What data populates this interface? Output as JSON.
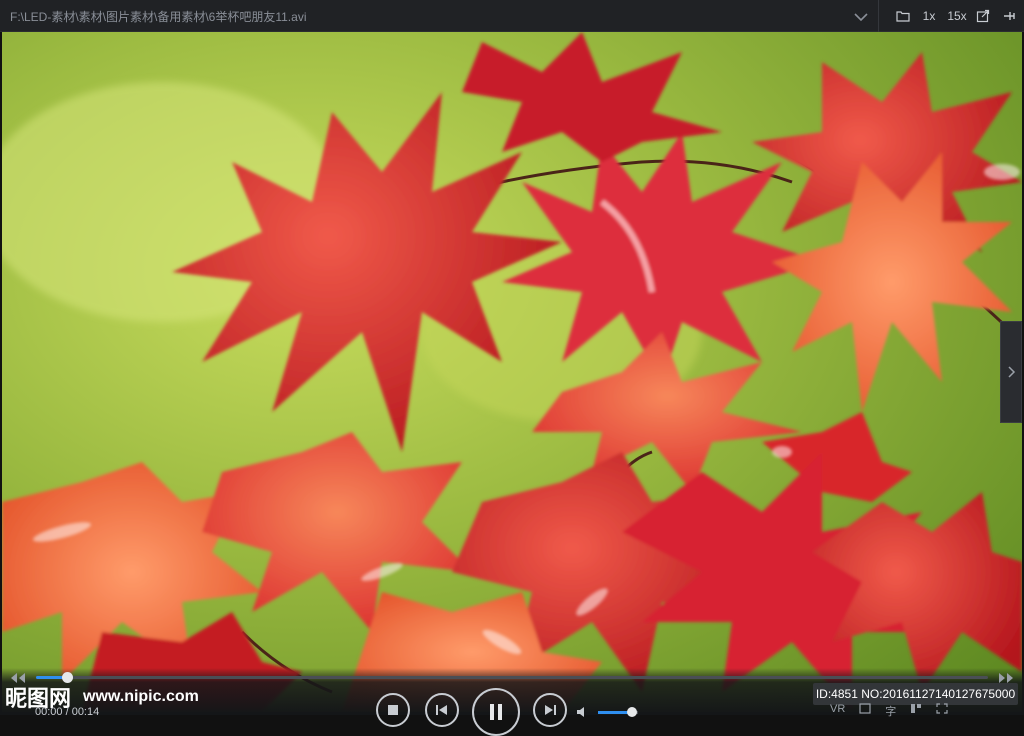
{
  "window": {
    "title": "F:\\LED-素材\\素材\\图片素材\\备用素材\\6举杯吧朋友11.avi"
  },
  "toolbar": {
    "speed_1x": "1x",
    "speed_15x": "15x",
    "icons": [
      "chevron-down-icon",
      "folder-icon",
      "speed-1x",
      "speed-15x",
      "export-icon",
      "pin-icon"
    ]
  },
  "playback": {
    "time": "00:00 / 00:14",
    "progress": 0.033,
    "volume": 0.85
  },
  "watermark": {
    "logo": "昵图网",
    "url": "www.nipic.com",
    "id_text": "ID:4851 NO:20161127140127675000"
  },
  "bottom_bar": {
    "vr_label": "VR",
    "text_label": "字"
  },
  "colors": {
    "accent": "#2f8ff0",
    "titlebar_bg": "#202225",
    "leaf_red": "#d8262a",
    "leaf_orange": "#e85a22",
    "background_green": "#9ab940"
  }
}
